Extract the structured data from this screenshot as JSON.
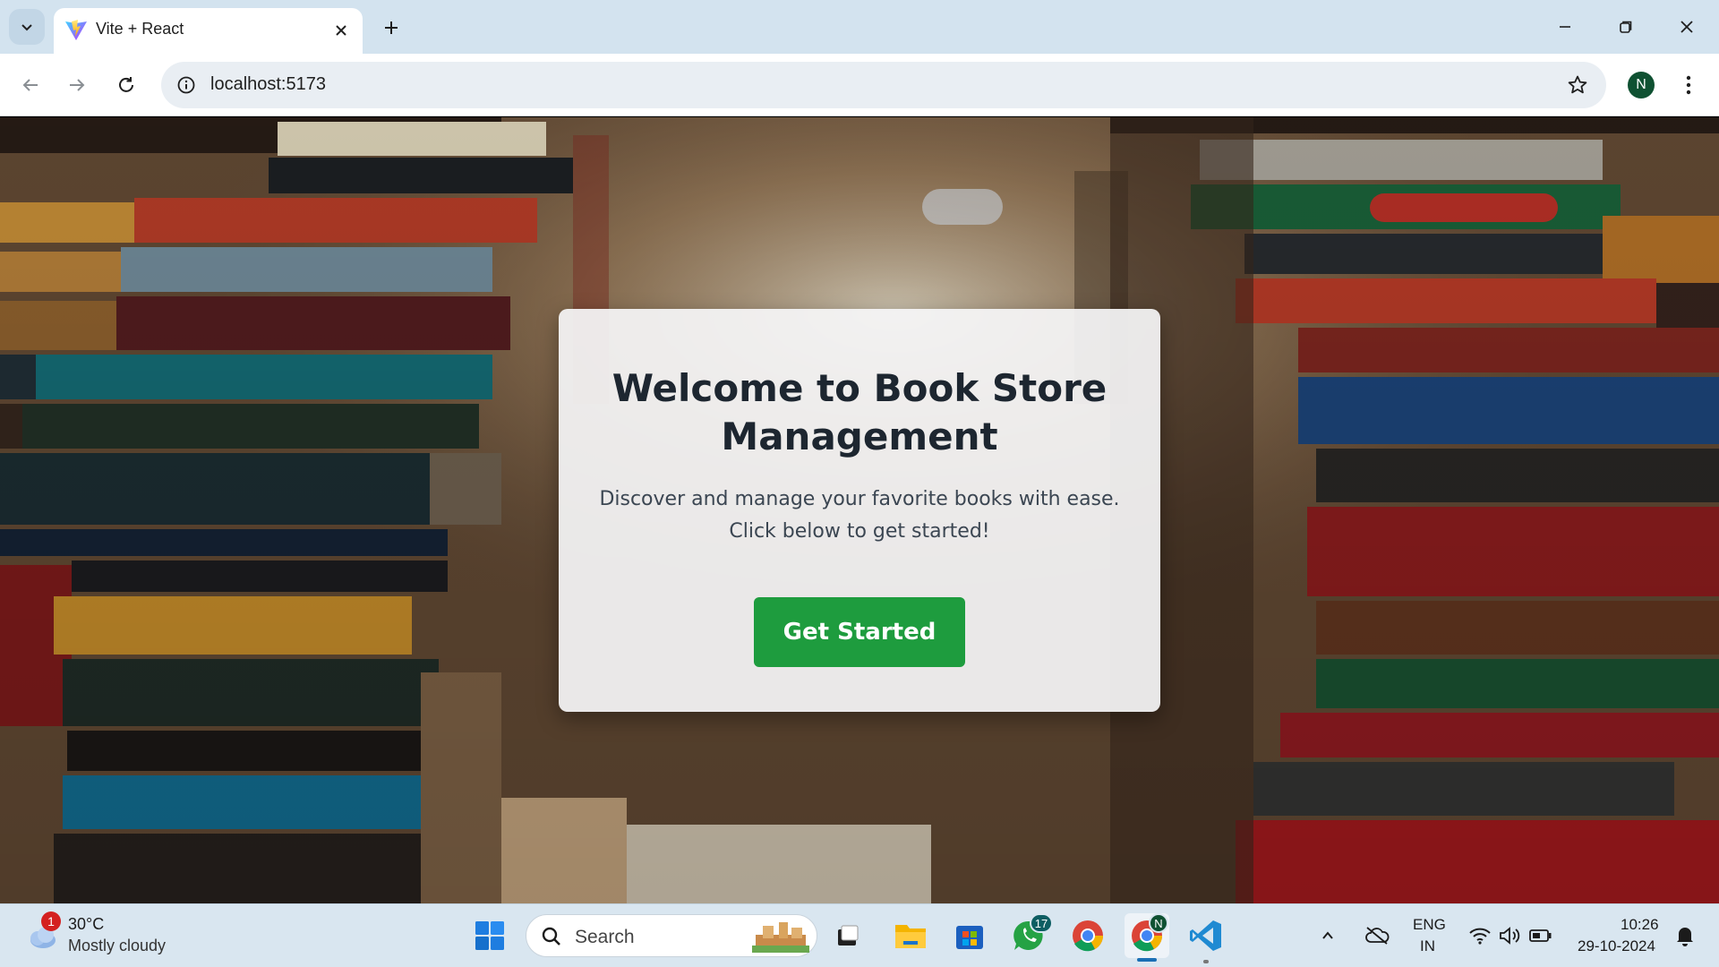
{
  "browser": {
    "tab": {
      "title": "Vite + React"
    },
    "address": {
      "url": "localhost:5173"
    },
    "profile": {
      "initial": "N"
    }
  },
  "page": {
    "heading": "Welcome to Book Store Management",
    "description_line1": "Discover and manage your favorite books with ease.",
    "description_line2": "Click below to get started!",
    "cta_label": "Get Started",
    "accent_color": "#1e9c3e"
  },
  "taskbar": {
    "weather": {
      "temp": "30°C",
      "condition": "Mostly cloudy",
      "alert_count": "1"
    },
    "search_label": "Search",
    "whatsapp_badge": "17",
    "chrome_profile_badge": "N",
    "language": {
      "line1": "ENG",
      "line2": "IN"
    },
    "clock": {
      "time": "10:26",
      "date": "29-10-2024"
    },
    "icons": [
      "start-icon",
      "search-icon",
      "task-view-icon",
      "file-explorer-icon",
      "microsoft-store-icon",
      "whatsapp-icon",
      "chrome-icon",
      "chrome-profile-icon",
      "vscode-icon"
    ]
  }
}
